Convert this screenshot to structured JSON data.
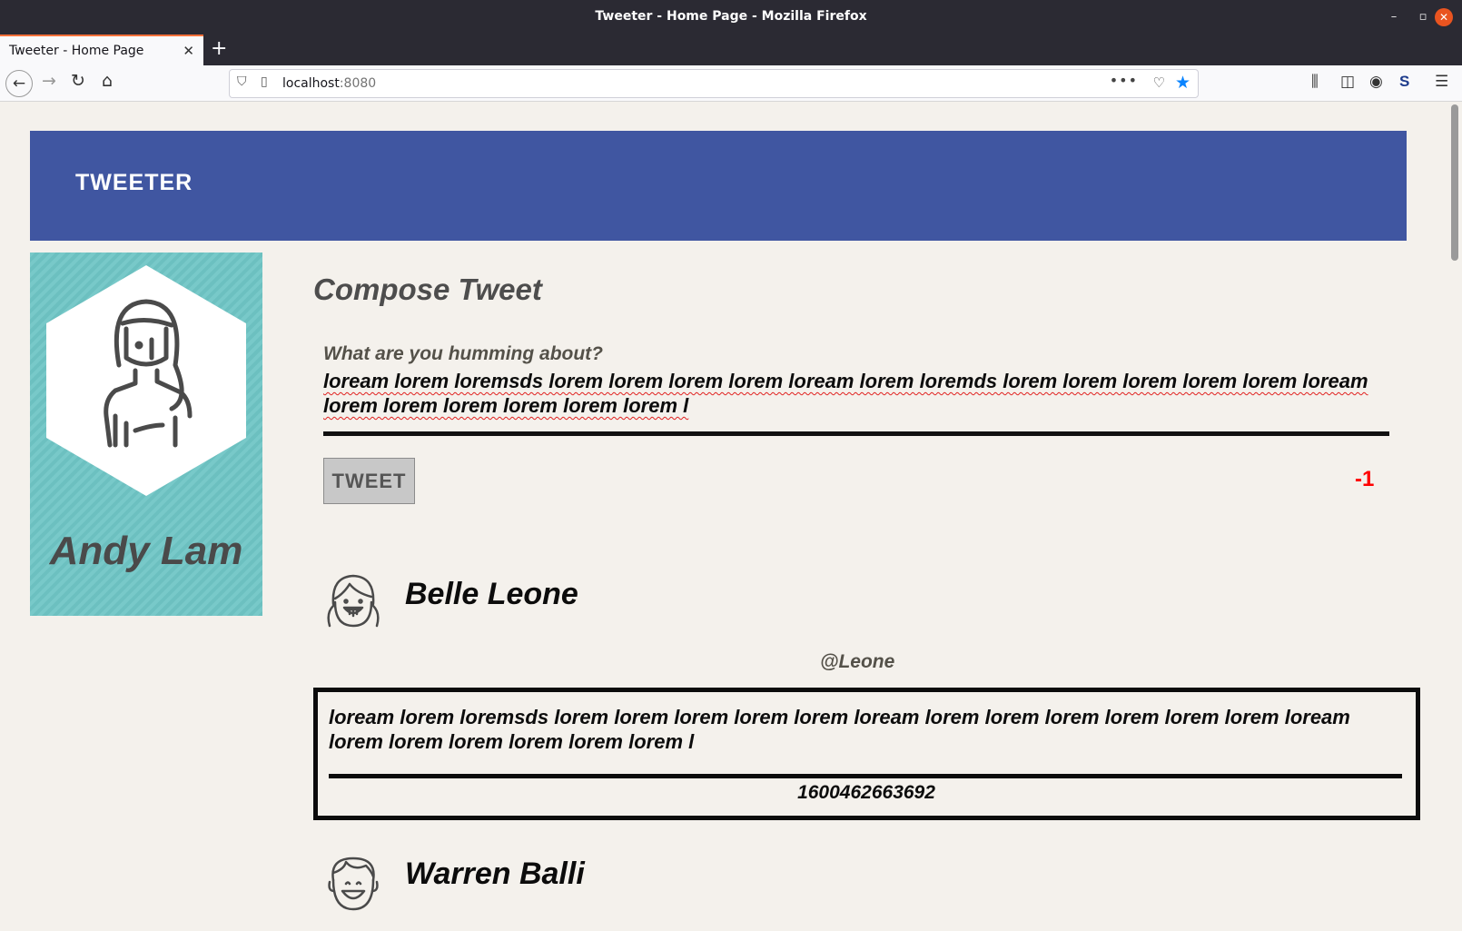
{
  "window": {
    "title": "Tweeter - Home Page - Mozilla Firefox"
  },
  "tab": {
    "title": "Tweeter - Home Page"
  },
  "address": {
    "host": "localhost",
    "port": ":8080"
  },
  "header": {
    "brand": "TWEETER",
    "color": "#4056a1"
  },
  "profile": {
    "name": "Andy Lam",
    "color": "#70c6c6"
  },
  "compose": {
    "title": "Compose Tweet",
    "prompt": "What are you humming about?",
    "text": "loream lorem loremsds lorem lorem lorem lorem loream lorem loremds lorem lorem lorem lorem lorem loream lorem lorem lorem lorem lorem lorem l",
    "button_label": "TWEET",
    "counter": "-1",
    "counter_color": "#ff0000"
  },
  "tweets": [
    {
      "name": "Belle Leone",
      "handle": "@Leone",
      "text": "loream lorem loremsds lorem lorem lorem lorem lorem loream lorem lorem lorem lorem lorem lorem loream lorem lorem lorem lorem lorem lorem l",
      "timestamp": "1600462663692",
      "avatar_icon": "girl-avatar-icon"
    },
    {
      "name": "Warren Balli",
      "avatar_icon": "boy-avatar-icon"
    }
  ]
}
